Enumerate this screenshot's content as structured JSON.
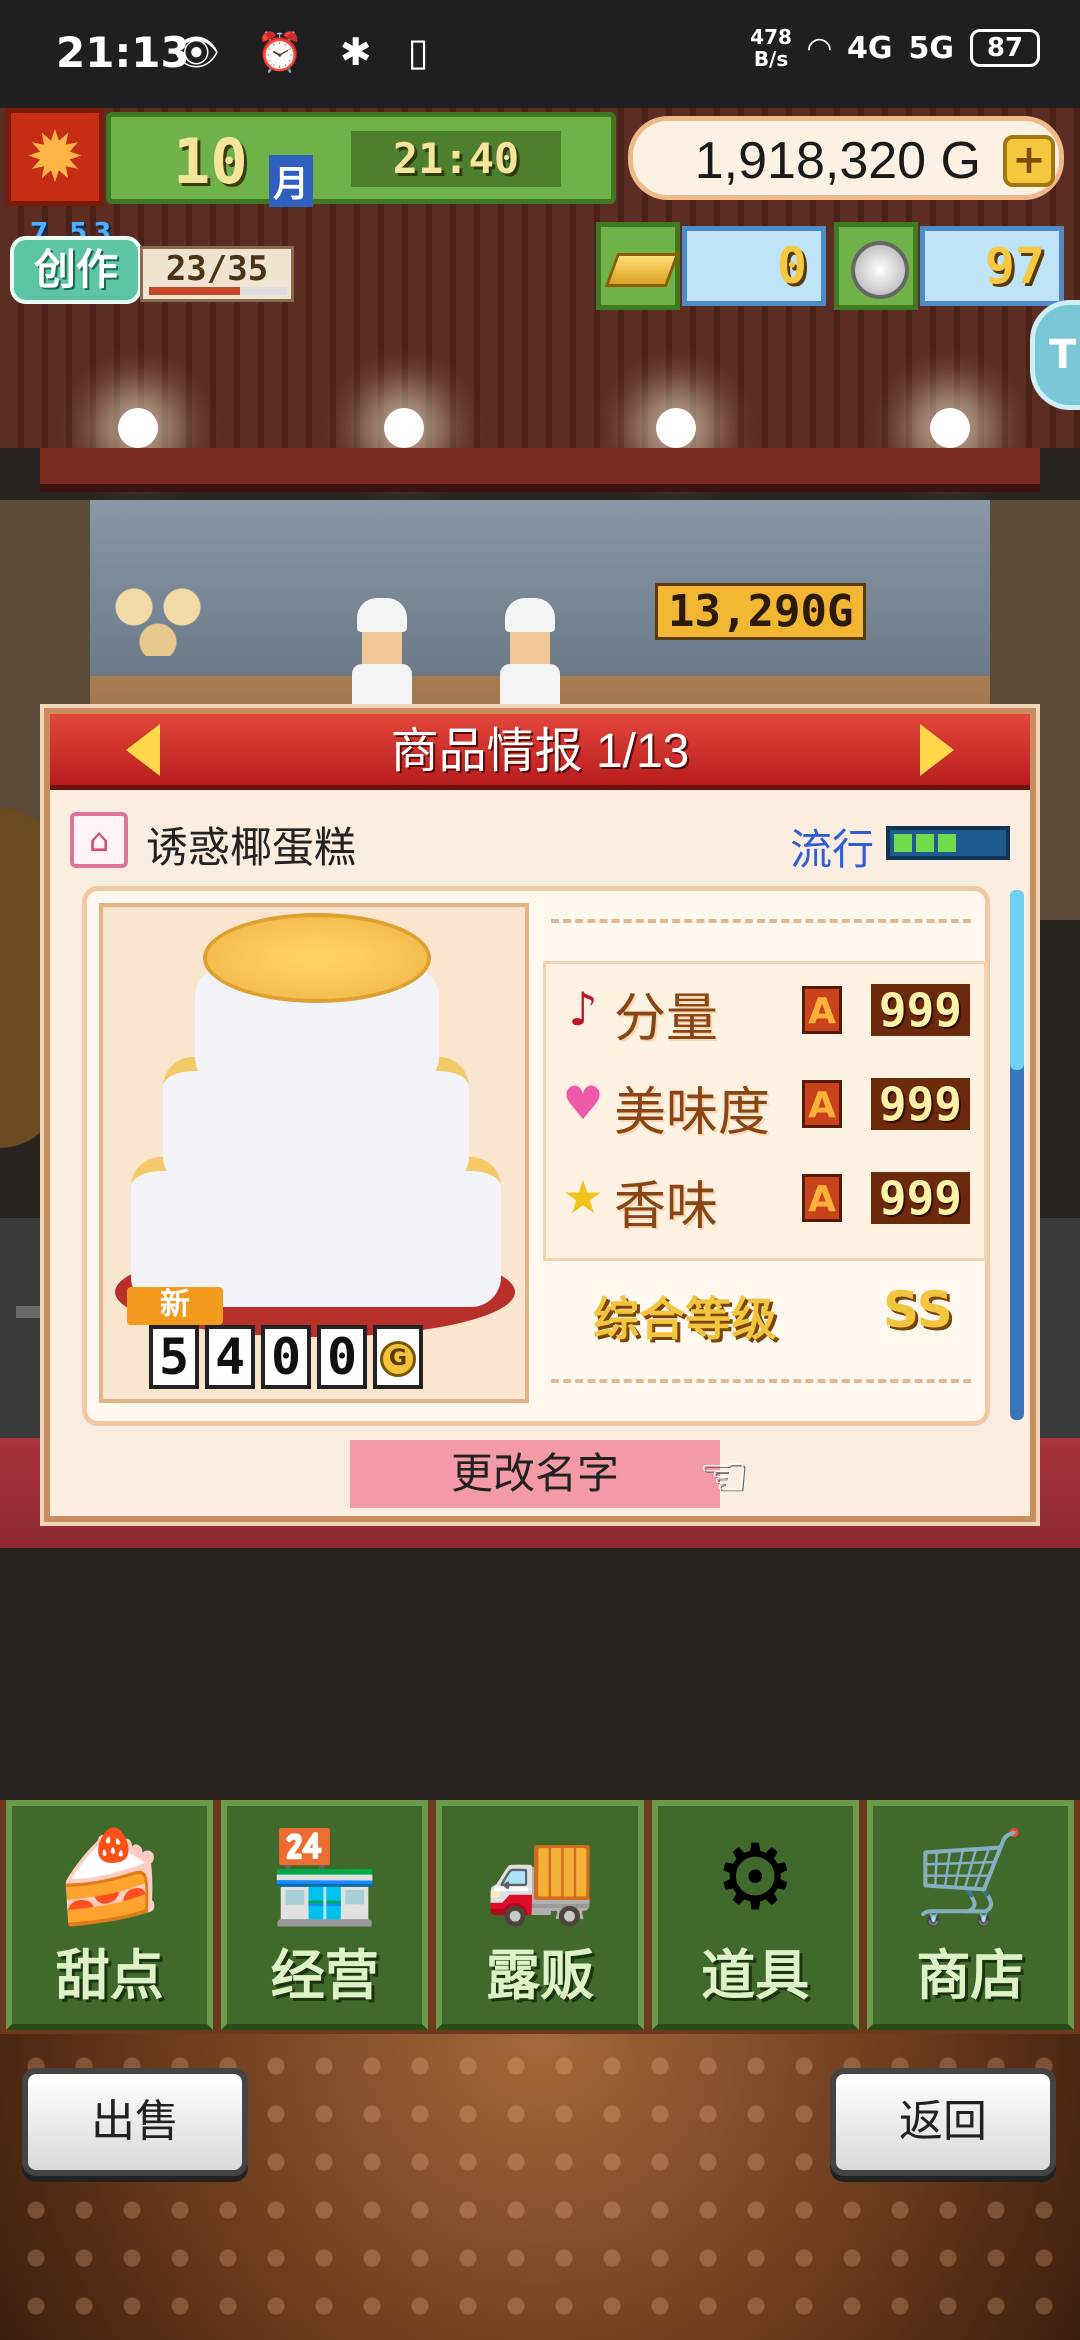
{
  "status_bar": {
    "time": "21:13",
    "left_icons": "👁 ⏰ ✱ ▯",
    "speed_value": "478",
    "speed_unit": "B/s",
    "signal_4g": "4G",
    "signal_5g": "5G",
    "battery": "87"
  },
  "hud": {
    "month_number": "10",
    "month_unit": "月",
    "clock": "21:40",
    "money": "1,918,320 G",
    "money_plus": "+",
    "create_label": "创作",
    "create_level": "7 53",
    "create_count": "23/35",
    "create_progress": 0.66,
    "gold_bars": "0",
    "silver_coins": "97",
    "side_button": "T"
  },
  "scene": {
    "floating_price": "13,290G"
  },
  "dialog": {
    "title": "商品情报 1/13",
    "item_name": "诱惑椰蛋糕",
    "item_icon": "cake-icon",
    "trend_label": "流行",
    "trend_level": 3,
    "new_badge": "新",
    "price_digits": [
      "5",
      "4",
      "0",
      "0"
    ],
    "price_unit": "G",
    "stats": [
      {
        "icon": "music-note-icon",
        "glyph": "♪",
        "color": "#c0162a",
        "label": "分量",
        "grade": "A",
        "value": "999"
      },
      {
        "icon": "heart-icon",
        "glyph": "♥",
        "color": "#ef5aa8",
        "label": "美味度",
        "grade": "A",
        "value": "999"
      },
      {
        "icon": "star-icon",
        "glyph": "★",
        "color": "#f4c21d",
        "label": "香味",
        "grade": "A",
        "value": "999"
      }
    ],
    "overall_label": "综合等级",
    "overall_value": "SS",
    "rename_button": "更改名字",
    "hand_glyph": "☜"
  },
  "nav": [
    {
      "name": "nav-dessert",
      "icon": "cake-slice-icon",
      "glyph": "🍰",
      "label": "甜点"
    },
    {
      "name": "nav-management",
      "icon": "shop-icon",
      "glyph": "🏪",
      "label": "经营"
    },
    {
      "name": "nav-stall",
      "icon": "food-truck-icon",
      "glyph": "🚚",
      "label": "露贩"
    },
    {
      "name": "nav-items",
      "icon": "gear-bag-icon",
      "glyph": "⚙",
      "label": "道具"
    },
    {
      "name": "nav-shop",
      "icon": "cart-icon",
      "glyph": "🛒",
      "label": "商店"
    }
  ],
  "footer": {
    "sell_button": "出售",
    "back_button": "返回"
  }
}
